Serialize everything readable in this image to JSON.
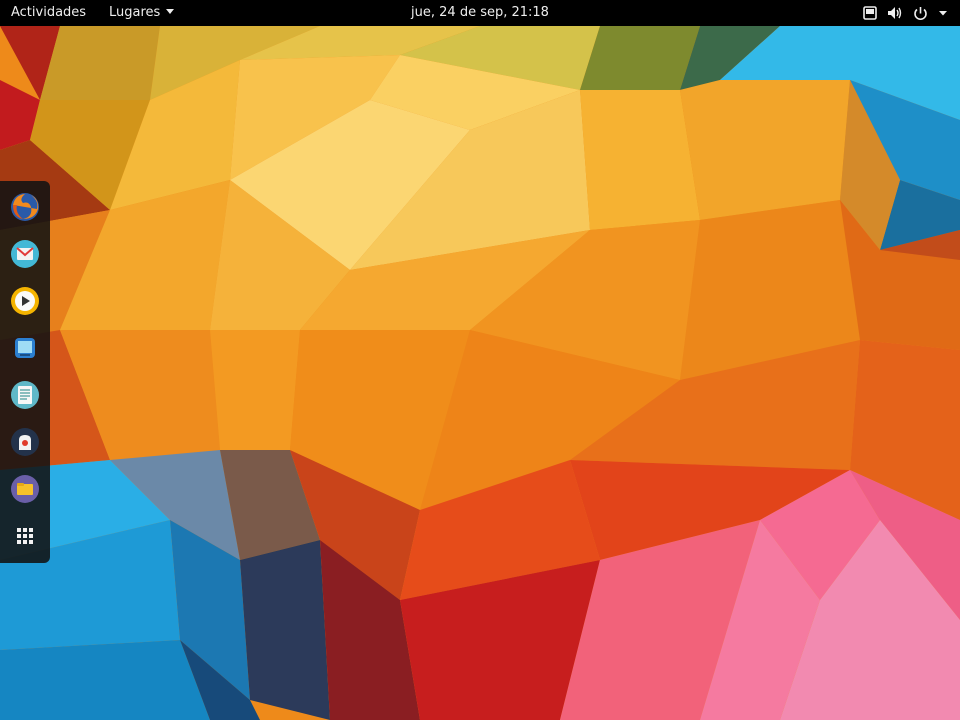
{
  "topbar": {
    "activities_label": "Actividades",
    "places_label": "Lugares",
    "clock": "jue, 24 de sep, 21:18"
  },
  "tray": {
    "icons": [
      "screen-icon",
      "volume-icon",
      "power-icon",
      "chevron-down-icon"
    ]
  },
  "dash": {
    "apps": [
      {
        "name": "firefox",
        "icon": "firefox-icon"
      },
      {
        "name": "mail",
        "icon": "mail-icon"
      },
      {
        "name": "media-player",
        "icon": "play-icon"
      },
      {
        "name": "screenshot",
        "icon": "screenshot-icon"
      },
      {
        "name": "text-editor",
        "icon": "notes-icon"
      },
      {
        "name": "software",
        "icon": "software-icon"
      },
      {
        "name": "files",
        "icon": "folder-icon"
      },
      {
        "name": "show-applications",
        "icon": "grid-icon"
      }
    ]
  },
  "colors": {
    "topbar_bg": "#000000",
    "dash_bg": "#121212",
    "wallpaper_orange": "#f0961c",
    "wallpaper_yellow": "#f7c04a",
    "wallpaper_blue": "#1fa4dc",
    "wallpaper_pink": "#f472a0",
    "wallpaper_red": "#d82a1e"
  }
}
